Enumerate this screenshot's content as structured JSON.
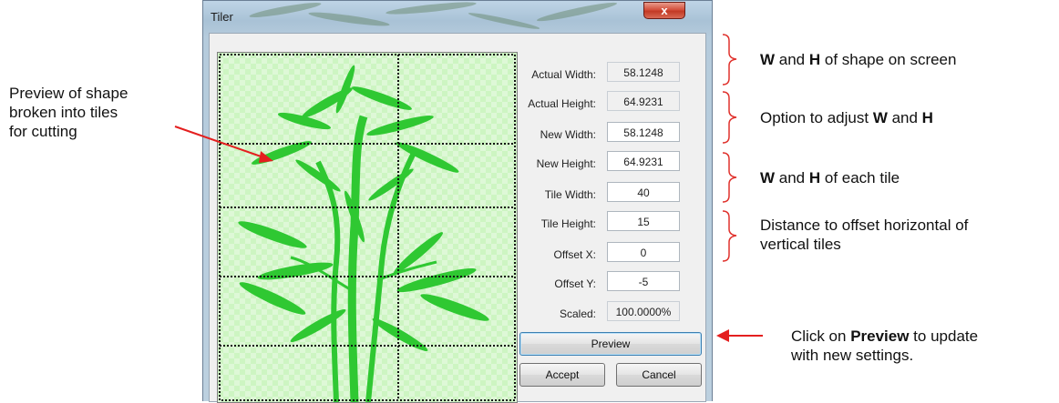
{
  "dialog": {
    "title": "Tiler",
    "close_glyph": "x",
    "fields": [
      {
        "label": "Actual Width:",
        "value": "58.1248",
        "readonly": true
      },
      {
        "label": "Actual Height:",
        "value": "64.9231",
        "readonly": true
      },
      {
        "label": "New Width:",
        "value": "58.1248",
        "readonly": false
      },
      {
        "label": "New Height:",
        "value": "64.9231",
        "readonly": false
      },
      {
        "label": "Tile Width:",
        "value": "40",
        "readonly": false
      },
      {
        "label": "Tile Height:",
        "value": "15",
        "readonly": false
      },
      {
        "label": "Offset X:",
        "value": "0",
        "readonly": false
      },
      {
        "label": "Offset Y:",
        "value": "-5",
        "readonly": false
      },
      {
        "label": "Scaled:",
        "value": "100.0000%",
        "readonly": true
      }
    ],
    "buttons": {
      "preview": "Preview",
      "accept": "Accept",
      "cancel": "Cancel"
    }
  },
  "annotations": {
    "left": [
      "Preview of shape",
      "broken into tiles",
      "for cutting"
    ],
    "wh_screen": {
      "p1": "W",
      "p2": " and ",
      "p3": "H",
      "p4": " of shape on screen"
    },
    "adjust": {
      "p1": "Option to adjust ",
      "p2": "W",
      "p3": " and ",
      "p4": "H"
    },
    "tile": {
      "p1": "W",
      "p2": " and ",
      "p3": "H",
      "p4": " of each tile"
    },
    "offset": [
      "Distance to offset horizontal of",
      "vertical tiles"
    ],
    "preview_note": {
      "p1": "Click on ",
      "p2": "Preview",
      "p3": " to update",
      "line2": "with new settings."
    }
  },
  "colors": {
    "bamboo": "#2fc832",
    "tile_bg": "#cdf5c2",
    "bracket": "#e0322d",
    "arrow": "#e41f1f"
  }
}
